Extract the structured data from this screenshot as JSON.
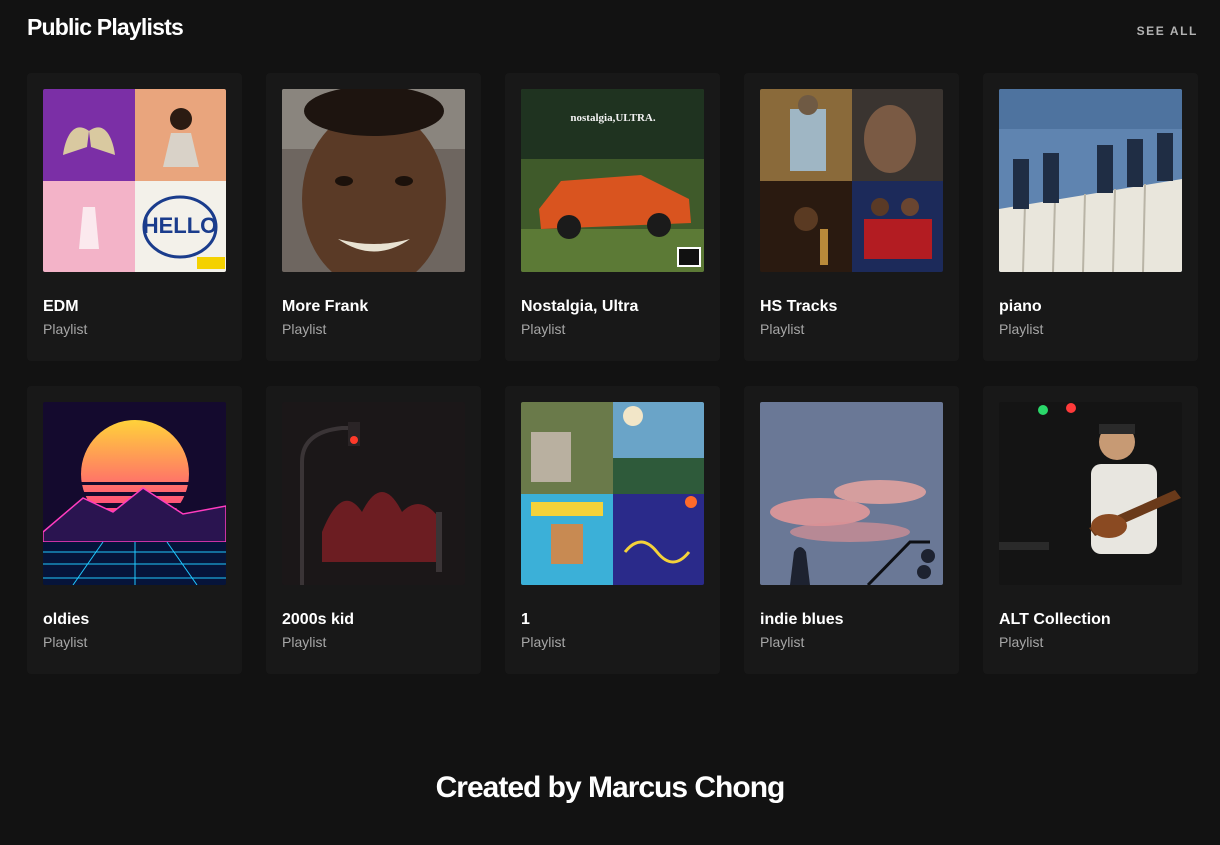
{
  "section": {
    "title": "Public Playlists",
    "see_all_label": "SEE ALL"
  },
  "playlists": [
    {
      "name": "EDM",
      "type": "Playlist",
      "cover": "mosaic-edm"
    },
    {
      "name": "More Frank",
      "type": "Playlist",
      "cover": "selfie-portrait"
    },
    {
      "name": "Nostalgia, Ultra",
      "type": "Playlist",
      "cover": "orange-car-album",
      "cover_text": "nostalgia,ULTRA."
    },
    {
      "name": "HS Tracks",
      "type": "Playlist",
      "cover": "mosaic-hs"
    },
    {
      "name": "piano",
      "type": "Playlist",
      "cover": "piano-keys"
    },
    {
      "name": "oldies",
      "type": "Playlist",
      "cover": "synthwave-sunset"
    },
    {
      "name": "2000s kid",
      "type": "Playlist",
      "cover": "traffic-light-night"
    },
    {
      "name": "1",
      "type": "Playlist",
      "cover": "mosaic-1"
    },
    {
      "name": "indie blues",
      "type": "Playlist",
      "cover": "pink-clouds"
    },
    {
      "name": "ALT Collection",
      "type": "Playlist",
      "cover": "guitarist-live"
    }
  ],
  "footer": {
    "credit": "Created by Marcus Chong"
  },
  "colors": {
    "background": "#121212",
    "card": "#181818",
    "subtext": "#a7a7a7"
  }
}
